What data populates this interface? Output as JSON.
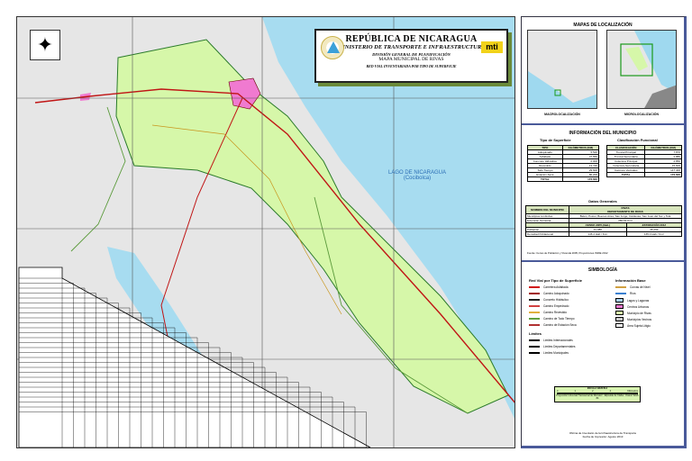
{
  "title_block": {
    "line1": "REPÚBLICA DE NICARAGUA",
    "line2": "MINISTERIO DE TRANSPORTE E INFRAESTRUCTURA",
    "line3": "DIVISIÓN GENERAL DE PLANIFICACIÓN",
    "line4": "MAPA MUNICIPAL DE RIVAS",
    "line5": "RED VIAL INVENTARIADA POR TIPO DE SUPERFICIE",
    "logo": "mti"
  },
  "map": {
    "lake_label": "LAGO DE NICARAGUA",
    "lake_label2": "(Cocibolca)",
    "compass": "north-arrow-icon"
  },
  "colors": {
    "land": "#e6e6e6",
    "water": "#a7dcf0",
    "municipio": "#d6f7a9",
    "urban": "#f07ad0",
    "roads_gravel": "#c8961e",
    "road_paved": "#c01515"
  },
  "location": {
    "title": "MAPAS DE LOCALIZACIÓN",
    "macro": "MACROLOCALIZACIÓN",
    "micro": "MICROLOCALIZACIÓN"
  },
  "info": {
    "title": "INFORMACIÓN DEL MUNICIPIO",
    "surface": {
      "title": "Tipo de Superficie",
      "col1": "TIPO",
      "col2": "KILÓMETROS (KM)",
      "rows": [
        [
          "Adoquinado",
          "5.520"
        ],
        [
          "Asfaltado",
          "47.550"
        ],
        [
          "Concreto Hidráulico",
          "0.000"
        ],
        [
          "Revestido",
          "13.730"
        ],
        [
          "Todo Tiempo",
          "29.600"
        ],
        [
          "Estación Seca",
          "80.200"
        ]
      ],
      "total": [
        "TOTAL",
        "176.600"
      ]
    },
    "functional": {
      "title": "Clasificación Funcional",
      "col1": "CLASIFICACIÓN",
      "col2": "KILÓMETROS (KM)",
      "rows": [
        [
          "Troncal Principal",
          "7.870"
        ],
        [
          "Troncal Secundaria",
          "2.880"
        ],
        [
          "Colectora Principal",
          "2.850"
        ],
        [
          "Colectora Secundaria",
          "15.600"
        ],
        [
          "Caminos Vecinales",
          "147.400"
        ]
      ],
      "total": [
        "TOTAL",
        "176.600"
      ]
    },
    "general": {
      "title": "Datos Generales",
      "name_label": "NOMBRE DEL MUNICIPIO",
      "name_value": "RIVAS",
      "dept": "DEPARTAMENTO DE RIVAS",
      "neighbors_label": "Municipios Limítrofes",
      "neighbors": "Belén, Potosí, Buenos Aires, San Jorge, Cárdenas, San Juan del Sur y Tola",
      "area_label": "Extensión Territorial",
      "area": "280.54 Km²",
      "census": "CENSO 2005 (Hab.)",
      "estimate": "ESTIMACIÓN 2012",
      "pop_label": "Población",
      "pop_2005": "41,080",
      "pop_2012": "46,293",
      "dens_label": "Densidad Poblacional",
      "dens_2005": "146.4 Hab / Km²",
      "dens_2012": "165.0 Hab / Km²"
    },
    "source": "Fuente: Censo de Población y Vivienda 2005, Proyecciones INIDE 2012"
  },
  "legend": {
    "title": "SIMBOLOGÍA",
    "roads_title": "Red Vial por Tipo de Superficie",
    "roads": [
      [
        "Carretera Asfaltada",
        "#d01010"
      ],
      [
        "Camino Adoquinado",
        "#a01010"
      ],
      [
        "Concreto Hidráulico",
        "#202020"
      ],
      [
        "Camino Empedrado",
        "#d04040"
      ],
      [
        "Camino Revestido",
        "#e0b040"
      ],
      [
        "Camino de Todo Tiempo",
        "#60a040"
      ],
      [
        "Camino de Estación Seca",
        "#b03030"
      ]
    ],
    "limits_title": "Límites",
    "limits": [
      "Límites Internacionales",
      "Límites Departamentales",
      "Límites Municipales"
    ],
    "base_title": "Información Base",
    "base": [
      [
        "Curvas de Nivel",
        "line",
        "#d0a040"
      ],
      [
        "Ríos",
        "line",
        "#3a80d0"
      ],
      [
        "Lagos y Lagunas",
        "box",
        "#a7d0f0"
      ],
      [
        "Centros Urbanos",
        "box",
        "#f07ad0"
      ],
      [
        "Municipio de Rivas",
        "box",
        "#d6f7a9"
      ],
      [
        "Municipios Vecinos",
        "box",
        "#c8c8c8"
      ],
      [
        "Área Sujeta Litigio",
        "box",
        "#ffffff"
      ]
    ]
  },
  "scale": {
    "title": "ESCALA GRÁFICA",
    "ticks": [
      "0",
      "1",
      "2",
      "4"
    ],
    "unit": "Kilómetros",
    "note": "Proyección Universal Transversal de Mercator - Elipsoide de Clarke - Datum WGS 84"
  },
  "footer": {
    "line1": "Oficina de Inventario de la Infraestructura de Transporte",
    "line2": "Fecha de Impresión: Agosto 2013"
  }
}
